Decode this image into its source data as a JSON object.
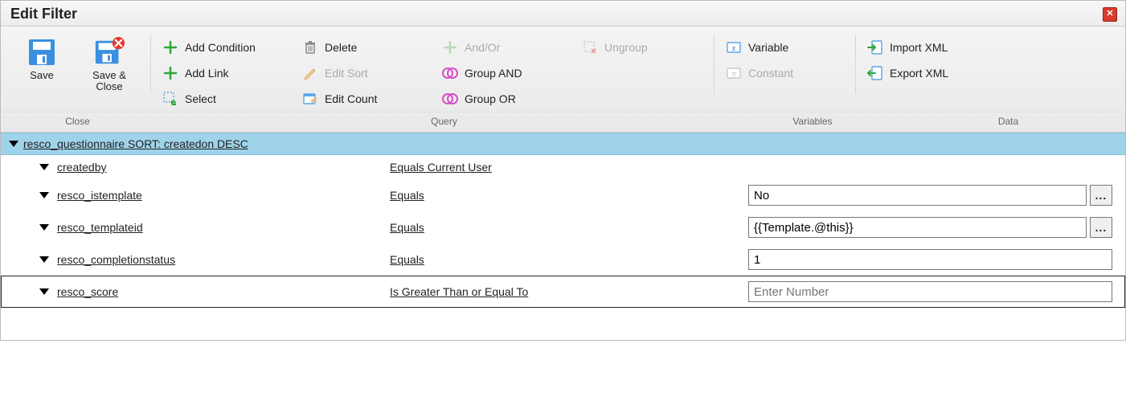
{
  "title": "Edit Filter",
  "ribbon": {
    "groups": {
      "close": {
        "label": "Close",
        "save": "Save",
        "save_close": "Save & Close"
      },
      "query": {
        "label": "Query",
        "add_condition": "Add Condition",
        "add_link": "Add Link",
        "select": "Select",
        "delete": "Delete",
        "edit_sort": "Edit Sort",
        "edit_count": "Edit Count",
        "and_or": "And/Or",
        "group_and": "Group AND",
        "group_or": "Group OR",
        "ungroup": "Ungroup"
      },
      "variables": {
        "label": "Variables",
        "variable": "Variable",
        "constant": "Constant"
      },
      "data": {
        "label": "Data",
        "import_xml": "Import XML",
        "export_xml": "Export XML"
      }
    }
  },
  "filter": {
    "root": "resco_questionnaire SORT: createdon DESC",
    "rows": [
      {
        "field": "createdby",
        "operator": "Equals Current User",
        "value": null,
        "has_input": false,
        "has_picker": false,
        "placeholder": "",
        "selected": false
      },
      {
        "field": "resco_istemplate",
        "operator": "Equals",
        "value": "No",
        "has_input": true,
        "has_picker": true,
        "placeholder": "",
        "selected": false
      },
      {
        "field": "resco_templateid",
        "operator": "Equals",
        "value": "{{Template.@this}}",
        "has_input": true,
        "has_picker": true,
        "placeholder": "",
        "selected": false
      },
      {
        "field": "resco_completionstatus",
        "operator": "Equals",
        "value": "1",
        "has_input": true,
        "has_picker": false,
        "placeholder": "",
        "selected": false
      },
      {
        "field": "resco_score",
        "operator": "Is Greater Than or Equal To",
        "value": "",
        "has_input": true,
        "has_picker": false,
        "placeholder": "Enter Number",
        "selected": true
      }
    ]
  },
  "glyphs": {
    "ellipsis": "..."
  }
}
